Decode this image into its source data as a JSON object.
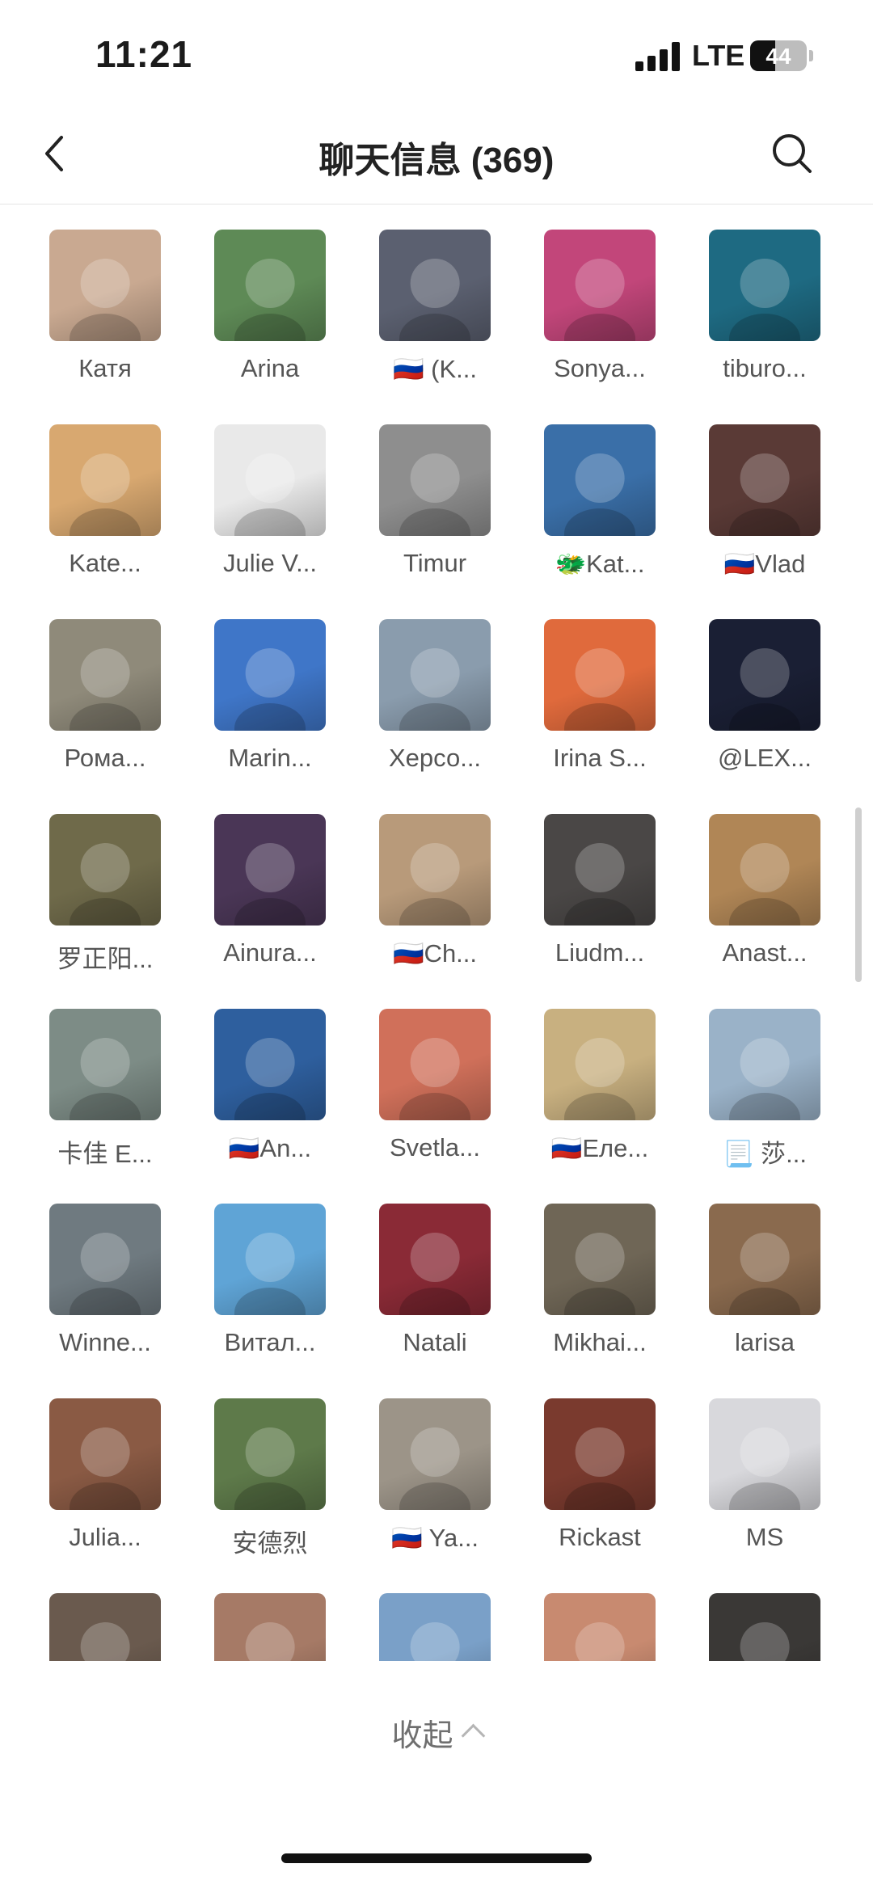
{
  "status_bar": {
    "time": "11:21",
    "network": "LTE",
    "battery": "44",
    "battery_level": 0.44
  },
  "nav": {
    "title": "聊天信息 (369)",
    "back_icon": "chevron-left-icon",
    "search_icon": "search-icon"
  },
  "members": [
    {
      "name": "Катя",
      "color": "#c9a991"
    },
    {
      "name": "Arina",
      "color": "#5e8a56"
    },
    {
      "name": "🇷🇺 (K...",
      "color": "#5b6070"
    },
    {
      "name": "Sonya...",
      "color": "#c2467a"
    },
    {
      "name": "tiburo...",
      "color": "#1e6a82"
    },
    {
      "name": "Kate...",
      "color": "#d8a870"
    },
    {
      "name": "Julie V...",
      "color": "#e9e9e9"
    },
    {
      "name": "Timur",
      "color": "#8e8e8e"
    },
    {
      "name": "🐲Kat...",
      "color": "#3a6fa8"
    },
    {
      "name": "🇷🇺Vlad",
      "color": "#5a3a36"
    },
    {
      "name": "Рома...",
      "color": "#8f8a7a"
    },
    {
      "name": "Marin...",
      "color": "#3f76c8"
    },
    {
      "name": "Херсо...",
      "color": "#8a9cad"
    },
    {
      "name": "Irina S...",
      "color": "#e06a3c"
    },
    {
      "name": "@LEX...",
      "color": "#1a1f34"
    },
    {
      "name": "罗正阳...",
      "color": "#6f6a4a"
    },
    {
      "name": "Ainura...",
      "color": "#4a3656"
    },
    {
      "name": "🇷🇺Ch...",
      "color": "#b89a7a"
    },
    {
      "name": "Liudm...",
      "color": "#4a4746"
    },
    {
      "name": "Anast...",
      "color": "#b08656"
    },
    {
      "name": "卡佳 E...",
      "color": "#7d8c86"
    },
    {
      "name": "🇷🇺An...",
      "color": "#2e5f9e"
    },
    {
      "name": "Svetla...",
      "color": "#d0705a"
    },
    {
      "name": "🇷🇺Еле...",
      "color": "#c8b080"
    },
    {
      "name": "📃 莎...",
      "color": "#9ab2c8"
    },
    {
      "name": "Winne...",
      "color": "#6f7a80"
    },
    {
      "name": "Витал...",
      "color": "#5fa4d6"
    },
    {
      "name": "Natali",
      "color": "#8a2a36"
    },
    {
      "name": "Mikhai...",
      "color": "#6f6656"
    },
    {
      "name": "larisa",
      "color": "#8a6a4e"
    },
    {
      "name": "Julia...",
      "color": "#8a5a44"
    },
    {
      "name": "安德烈",
      "color": "#5e7a4a"
    },
    {
      "name": "🇷🇺 Ya...",
      "color": "#9c9488"
    },
    {
      "name": "Rickast",
      "color": "#7a3a2e"
    },
    {
      "name": "MS",
      "color": "#d8d8dc"
    },
    {
      "name": "",
      "color": "#6a5a4e"
    },
    {
      "name": "",
      "color": "#a67a66"
    },
    {
      "name": "",
      "color": "#7aa0c8"
    },
    {
      "name": "",
      "color": "#c88a70"
    },
    {
      "name": "",
      "color": "#3a3836"
    }
  ],
  "footer": {
    "collapse_label": "收起"
  }
}
